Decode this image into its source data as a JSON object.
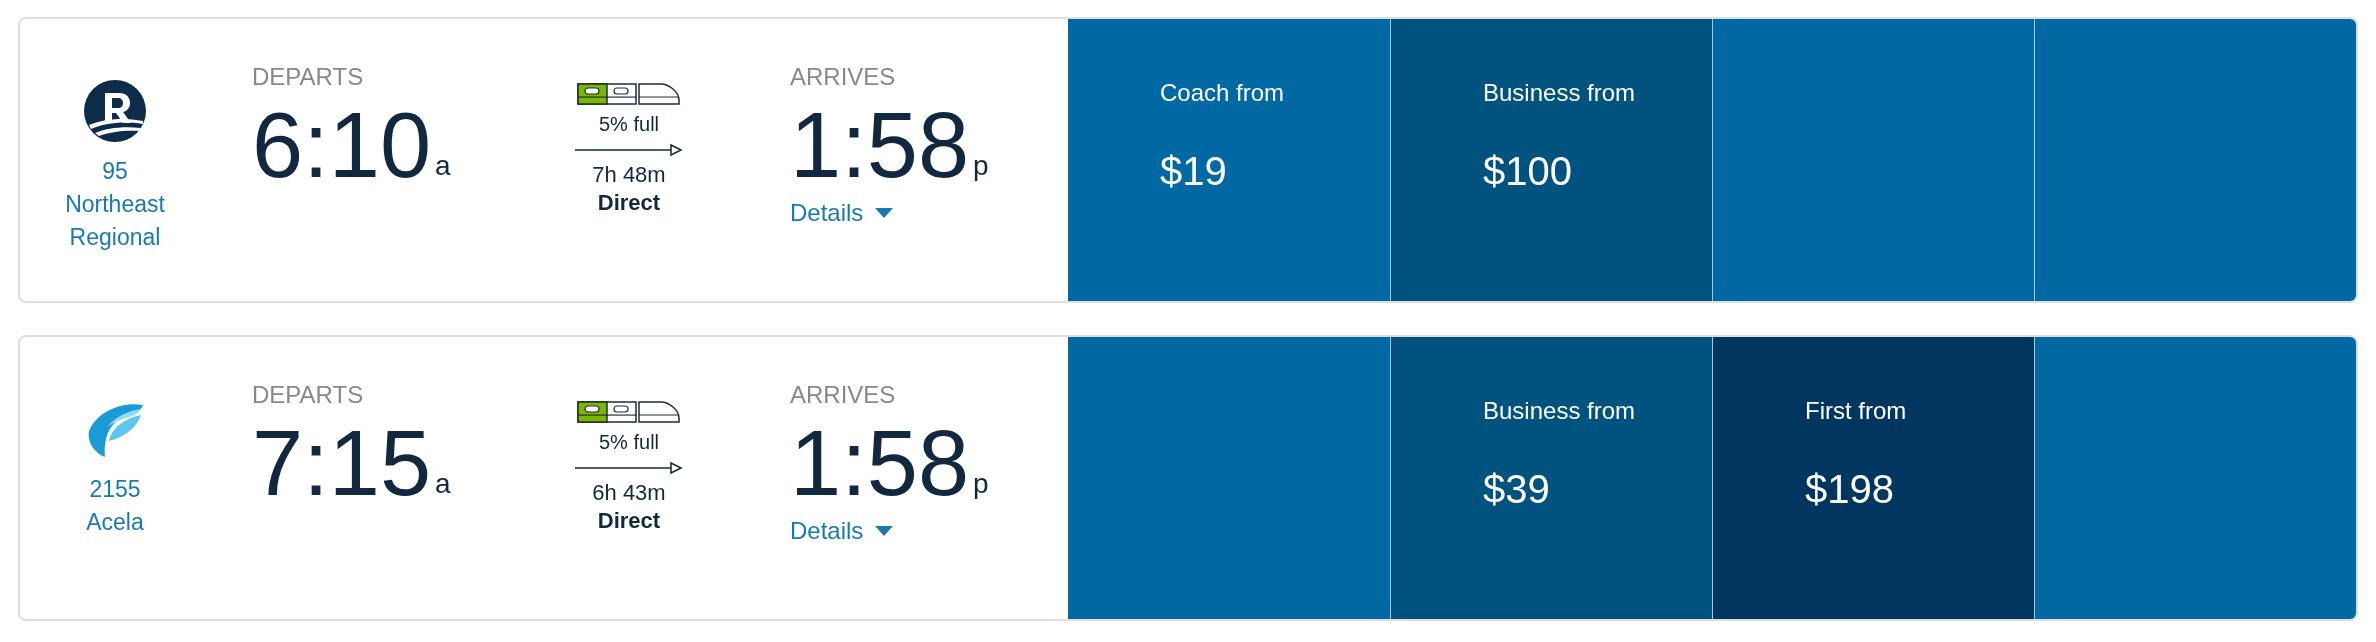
{
  "trains": [
    {
      "number": "95",
      "name": "Northeast Regional",
      "kind": "regional",
      "departs_label": "DEPARTS",
      "departs_time": "6:10",
      "departs_ampm": "a",
      "capacity": "5% full",
      "duration": "7h 48m",
      "stops": "Direct",
      "arrives_label": "ARRIVES",
      "arrives_time": "1:58",
      "arrives_ampm": "p",
      "details": "Details",
      "fares": [
        {
          "kind": "coach",
          "label": "Coach from",
          "price": "$19"
        },
        {
          "kind": "business",
          "label": "Business from",
          "price": "$100"
        },
        {
          "kind": "empty"
        },
        {
          "kind": "empty"
        }
      ]
    },
    {
      "number": "2155",
      "name": "Acela",
      "kind": "acela",
      "departs_label": "DEPARTS",
      "departs_time": "7:15",
      "departs_ampm": "a",
      "capacity": "5% full",
      "duration": "6h 43m",
      "stops": "Direct",
      "arrives_label": "ARRIVES",
      "arrives_time": "1:58",
      "arrives_ampm": "p",
      "details": "Details",
      "fares": [
        {
          "kind": "empty"
        },
        {
          "kind": "business",
          "label": "Business from",
          "price": "$39"
        },
        {
          "kind": "first",
          "label": "First from",
          "price": "$198"
        },
        {
          "kind": "empty"
        }
      ]
    }
  ]
}
